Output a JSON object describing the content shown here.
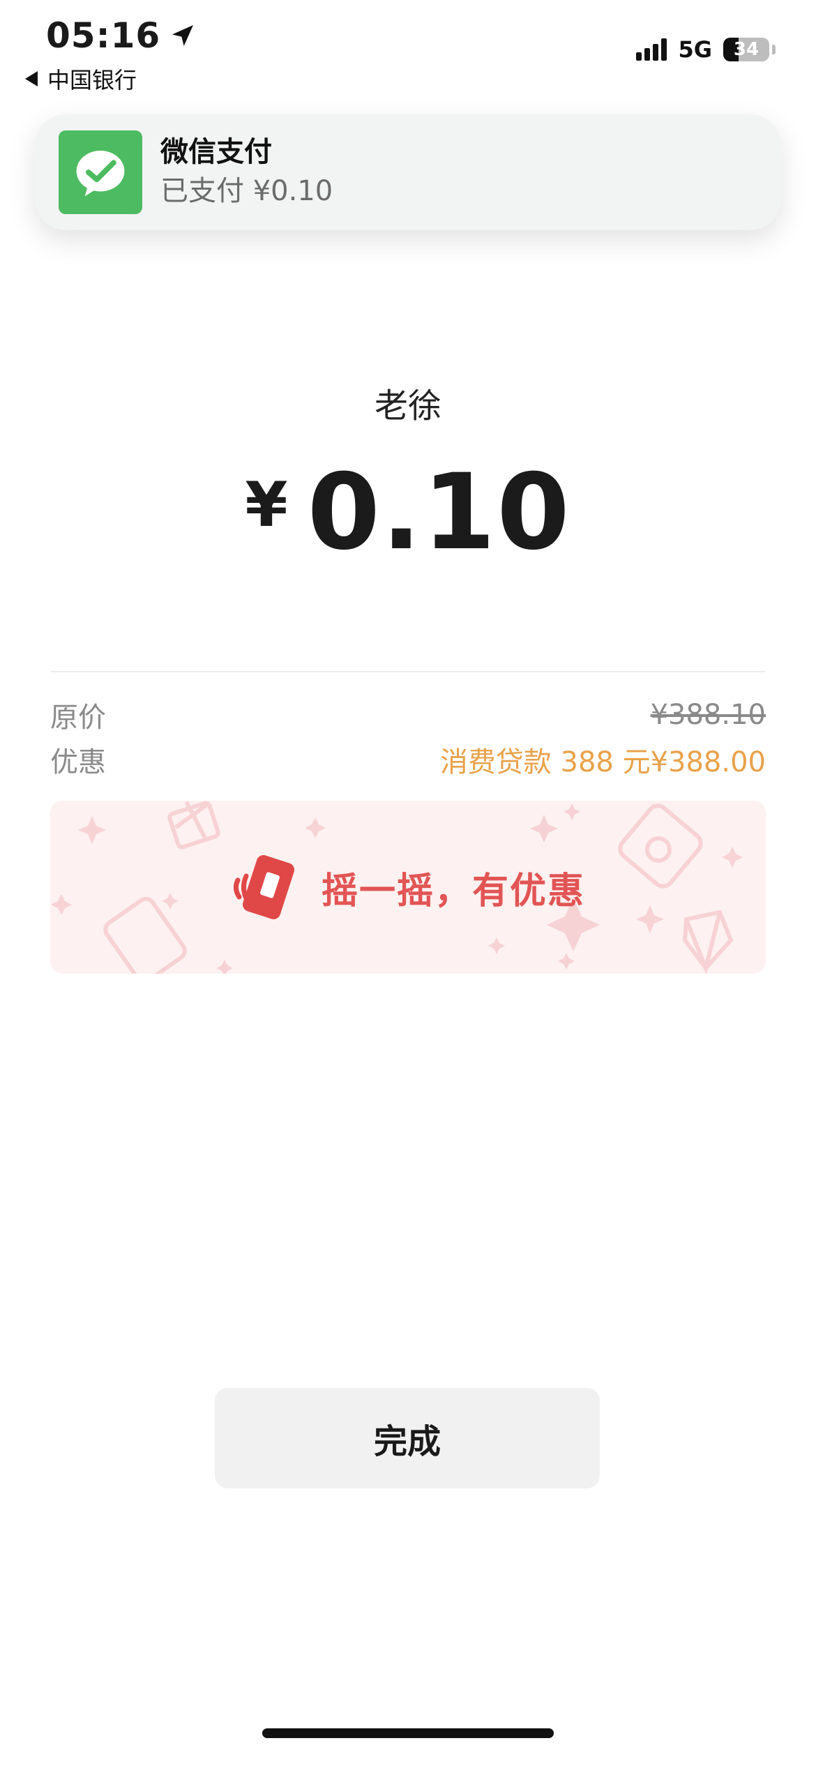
{
  "status_bar": {
    "time": "05:16",
    "back_app": "中国银行",
    "network": "5G",
    "battery": "34",
    "battery_level": 0.34
  },
  "notification": {
    "app_icon": "wechat-pay-icon",
    "title": "微信支付",
    "body": "已支付 ¥0.10"
  },
  "payment": {
    "payee": "老徐",
    "currency": "¥",
    "amount": "0.10"
  },
  "details": {
    "original_label": "原价",
    "original_value": "¥388.10",
    "discount_label": "优惠",
    "discount_value": "消费贷款 388 元¥388.00"
  },
  "promo": {
    "text": "摇一摇，有优惠",
    "icon": "shake-phone-icon"
  },
  "done_button": "完成",
  "colors": {
    "accent_green": "#4dbb61",
    "discount_orange": "#e8a24a",
    "promo_red": "#e25555"
  }
}
